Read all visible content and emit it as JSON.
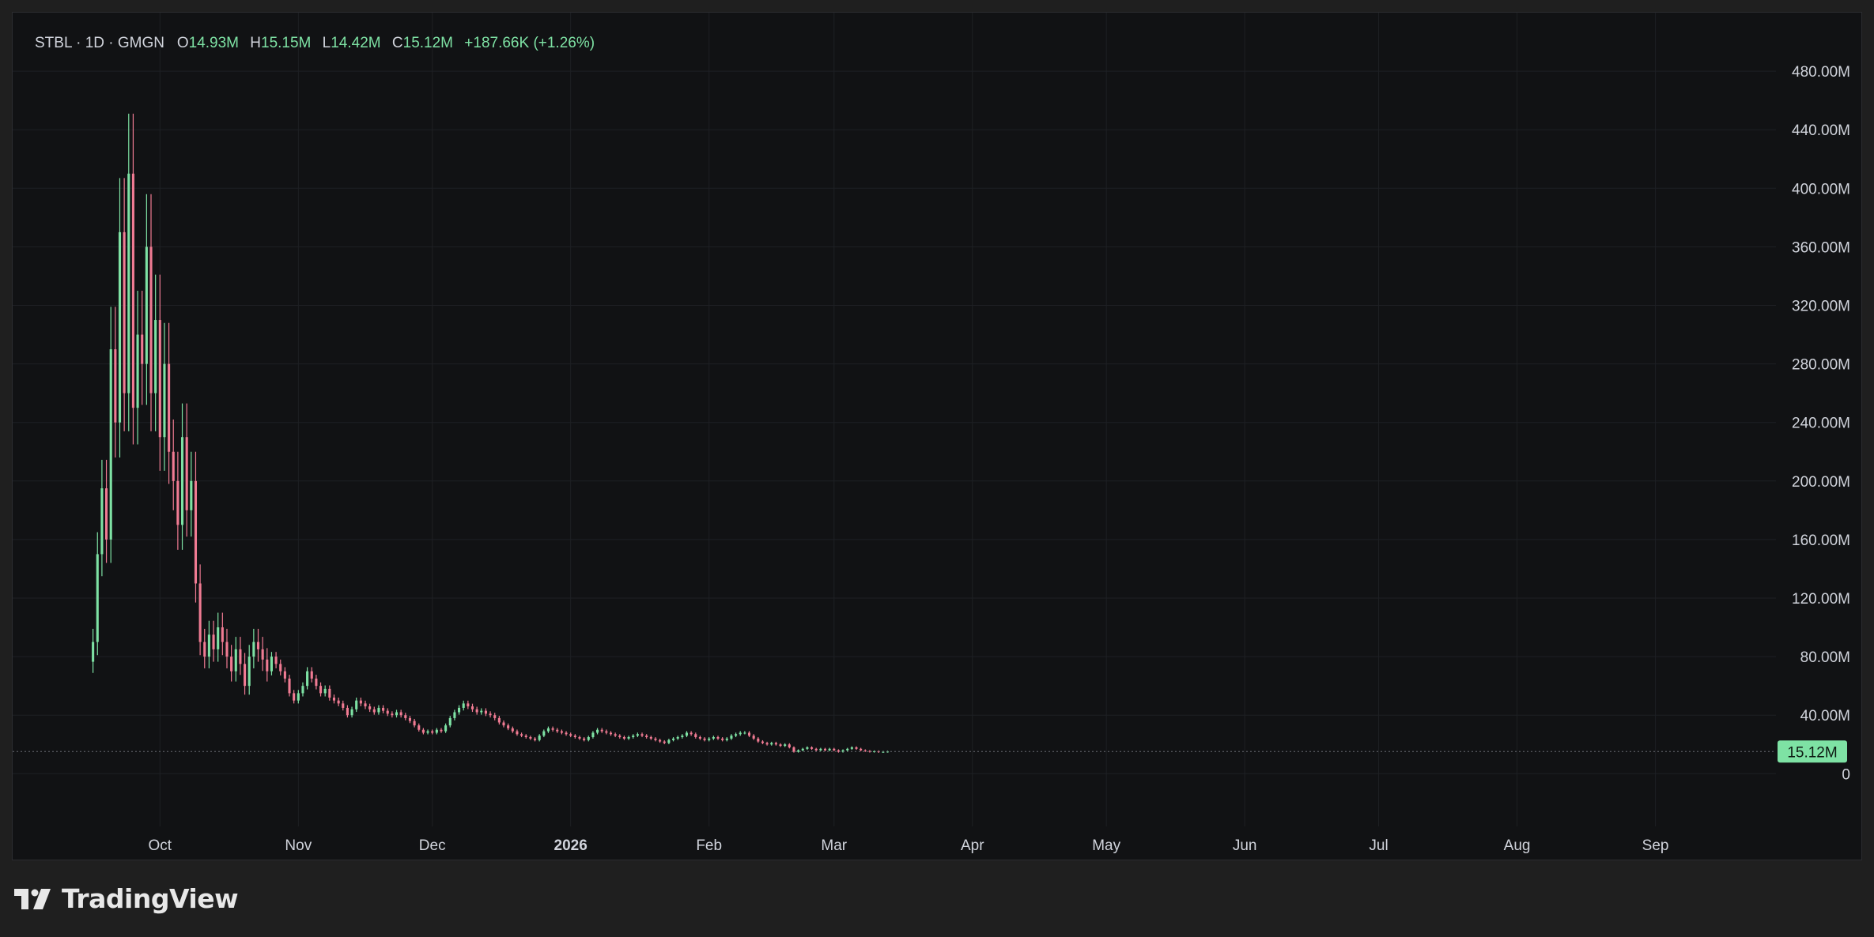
{
  "legend": {
    "symbol": "STBL · 1D · GMGN",
    "open_label": "O",
    "open": "14.93M",
    "high_label": "H",
    "high": "15.15M",
    "low_label": "L",
    "low": "14.42M",
    "close_label": "C",
    "close": "15.12M",
    "change": "+187.66K (+1.26%)"
  },
  "brand": {
    "name": "TradingView",
    "icon": "tradingview-logo-icon"
  },
  "colors": {
    "up": "#7ee2a4",
    "down": "#f07b93",
    "background": "#111214",
    "grid": "#1e2024",
    "text": "#d1d4dc",
    "price_tag": "#7ee2a4"
  },
  "chart_data": {
    "type": "candlestick",
    "title": "STBL · 1D · GMGN",
    "y_axis": {
      "ticks": [
        0,
        40,
        80,
        120,
        160,
        200,
        240,
        280,
        320,
        360,
        400,
        440,
        480
      ],
      "tick_labels": [
        "0",
        "40.00M",
        "80.00M",
        "120.00M",
        "160.00M",
        "200.00M",
        "240.00M",
        "280.00M",
        "320.00M",
        "360.00M",
        "400.00M",
        "440.00M",
        "480.00M"
      ],
      "unit": "M",
      "range": [
        -36,
        520
      ]
    },
    "x_axis": {
      "range": [
        "2025-08-29",
        "2026-09-28"
      ],
      "ticks": [
        {
          "date": "2025-10-01",
          "label": "Oct",
          "bold": false
        },
        {
          "date": "2025-11-01",
          "label": "Nov",
          "bold": false
        },
        {
          "date": "2025-12-01",
          "label": "Dec",
          "bold": false
        },
        {
          "date": "2026-01-01",
          "label": "2026",
          "bold": true
        },
        {
          "date": "2026-02-01",
          "label": "Feb",
          "bold": false
        },
        {
          "date": "2026-03-01",
          "label": "Mar",
          "bold": false
        },
        {
          "date": "2026-04-01",
          "label": "Apr",
          "bold": false
        },
        {
          "date": "2026-05-01",
          "label": "May",
          "bold": false
        },
        {
          "date": "2026-06-01",
          "label": "Jun",
          "bold": false
        },
        {
          "date": "2026-07-01",
          "label": "Jul",
          "bold": false
        },
        {
          "date": "2026-08-01",
          "label": "Aug",
          "bold": false
        },
        {
          "date": "2026-09-01",
          "label": "Sep",
          "bold": false
        }
      ]
    },
    "last_price": 15.12,
    "last_price_label": "15.12M",
    "grid": true,
    "series": [
      {
        "start_date": "2025-09-16",
        "close": [
          90,
          150,
          195,
          160,
          290,
          240,
          370,
          260,
          410,
          250,
          300,
          280,
          360,
          260,
          310,
          230,
          280,
          220,
          200,
          170,
          230,
          180,
          200,
          130,
          90,
          80,
          95,
          85,
          100,
          90,
          80,
          70,
          85,
          75,
          60,
          80,
          90,
          85,
          78,
          70,
          80,
          75,
          70,
          65,
          55,
          50,
          55,
          60,
          70,
          65,
          60,
          55,
          58,
          52,
          50,
          48,
          45,
          40,
          44,
          50,
          48,
          46,
          44,
          42,
          45,
          43,
          41,
          40,
          42,
          40,
          38,
          36,
          33,
          30,
          28,
          29,
          28,
          30,
          29,
          33,
          38,
          42,
          45,
          48,
          46,
          44,
          42,
          43,
          41,
          40,
          38,
          35,
          33,
          31,
          29,
          27,
          26,
          25,
          24,
          23,
          26,
          29,
          31,
          30,
          29,
          28,
          27,
          26,
          25,
          24,
          23,
          25,
          28,
          30,
          29,
          28,
          27,
          26,
          25,
          24,
          25,
          26,
          27,
          26,
          25,
          24,
          23,
          22,
          21,
          23,
          24,
          25,
          26,
          28,
          27,
          25,
          24,
          23,
          24,
          25,
          24,
          23,
          24,
          26,
          27,
          28,
          28,
          26,
          24,
          22,
          21,
          20,
          21,
          20,
          19,
          20,
          18,
          15,
          16,
          17,
          18,
          17,
          16,
          17,
          16,
          17,
          16,
          15,
          16,
          17,
          18,
          17,
          16,
          15.5,
          15,
          15.3,
          14.8,
          15,
          15.12
        ]
      }
    ]
  }
}
